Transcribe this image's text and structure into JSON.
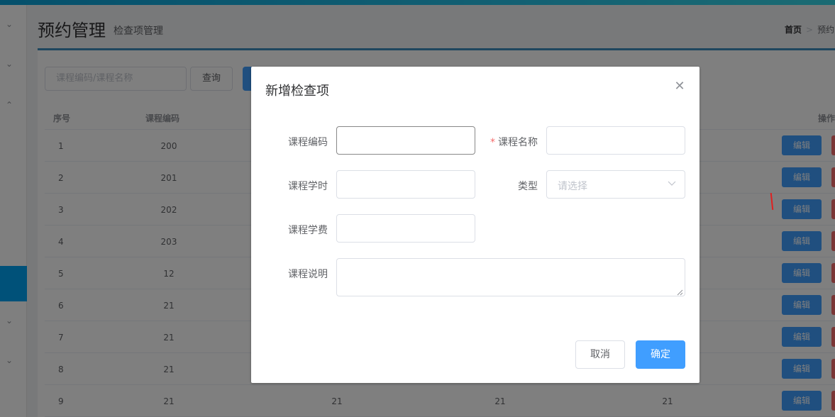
{
  "header": {
    "title": "预约管理",
    "subtitle": "检查项管理",
    "breadcrumb_home": "首页",
    "breadcrumb_sep": ">",
    "breadcrumb_current": "预约"
  },
  "toolbar": {
    "search_placeholder": "课程编码/课程名称",
    "query_label": "查询"
  },
  "table": {
    "columns": [
      "序号",
      "课程编码",
      "操作"
    ],
    "rows": [
      {
        "index": "1",
        "code": "200"
      },
      {
        "index": "2",
        "code": "201"
      },
      {
        "index": "3",
        "code": "202"
      },
      {
        "index": "4",
        "code": "203"
      },
      {
        "index": "5",
        "code": "12"
      },
      {
        "index": "6",
        "code": "21"
      },
      {
        "index": "7",
        "code": "21"
      },
      {
        "index": "8",
        "code": "21"
      },
      {
        "index": "9",
        "code": "21",
        "col3": "21",
        "col4": "21",
        "col5": "21"
      }
    ],
    "edit_label": "编辑"
  },
  "dialog": {
    "title": "新增检查项",
    "close_icon": "close-icon",
    "fields": {
      "code_label": "课程编码",
      "name_required": "*",
      "name_label": "课程名称",
      "hours_label": "课程学时",
      "type_label": "类型",
      "type_placeholder": "请选择",
      "fee_label": "课程学费",
      "desc_label": "课程说明"
    },
    "cancel_label": "取消",
    "ok_label": "确定"
  },
  "colors": {
    "primary": "#409eff",
    "danger": "#f56c6c",
    "sidebar_active": "#00a3f2",
    "header_accent": "#3c8dbc"
  }
}
